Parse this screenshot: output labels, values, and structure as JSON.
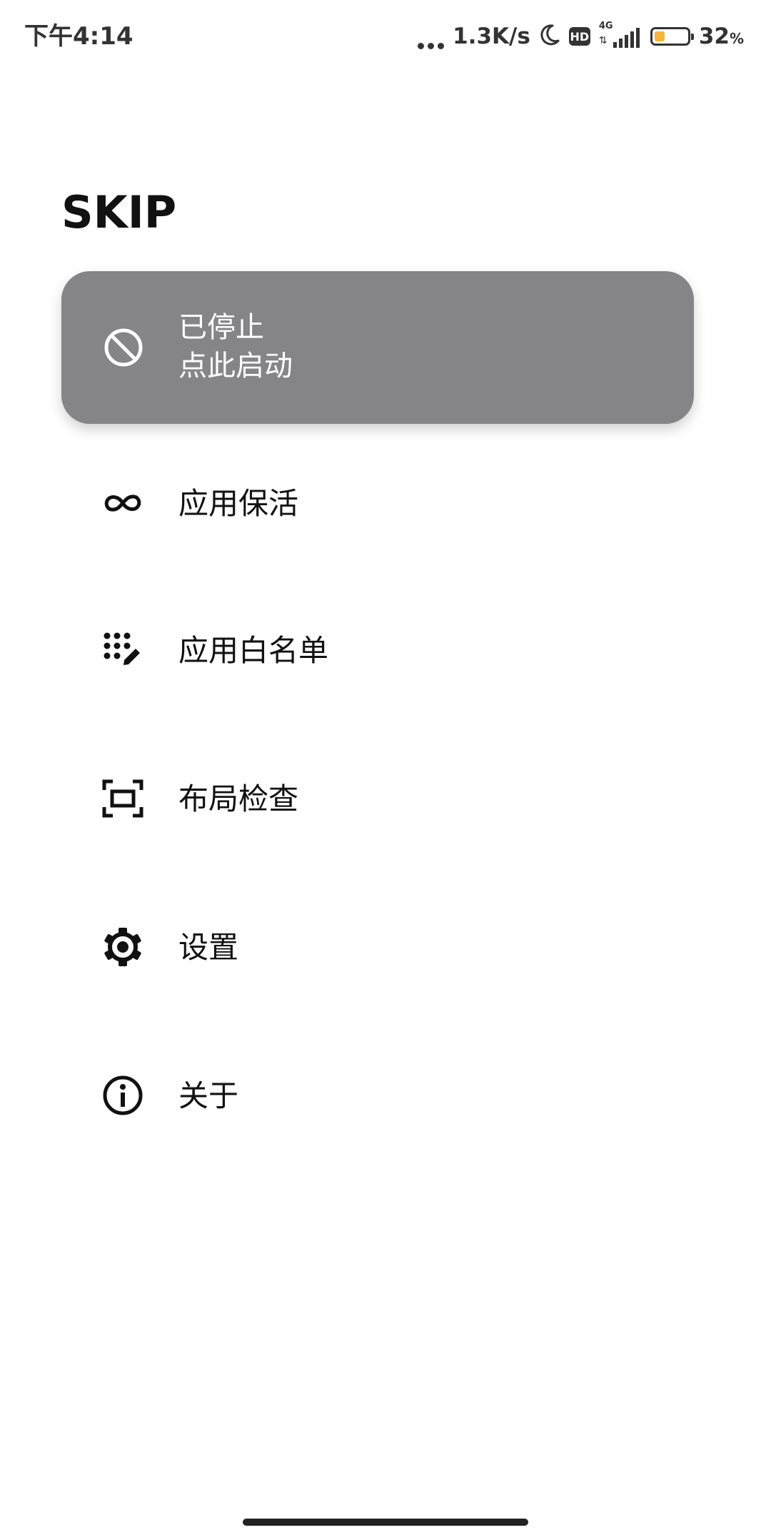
{
  "status_bar": {
    "time": "下午4:14",
    "net_speed": "1.3K/s",
    "hd_label": "HD",
    "network_label": "4G",
    "battery_percent_number": "32",
    "battery_percent_sign": "%",
    "battery_level": 0.32,
    "battery_color": "#f5b43a",
    "icons": [
      "more-dots-icon",
      "moon-icon",
      "hd-icon",
      "signal-icon",
      "battery-icon"
    ]
  },
  "app": {
    "title": "SKIP"
  },
  "service_card": {
    "icon": "block-icon",
    "status": "已停止",
    "action": "点此启动",
    "background_color": "#858487"
  },
  "menu": {
    "items": [
      {
        "icon": "infinity-icon",
        "label": "应用保活"
      },
      {
        "icon": "dialpad-edit-icon",
        "label": "应用白名单"
      },
      {
        "icon": "screen-frame-icon",
        "label": "布局检查"
      },
      {
        "icon": "gear-icon",
        "label": "设置"
      },
      {
        "icon": "info-icon",
        "label": "关于"
      }
    ]
  }
}
